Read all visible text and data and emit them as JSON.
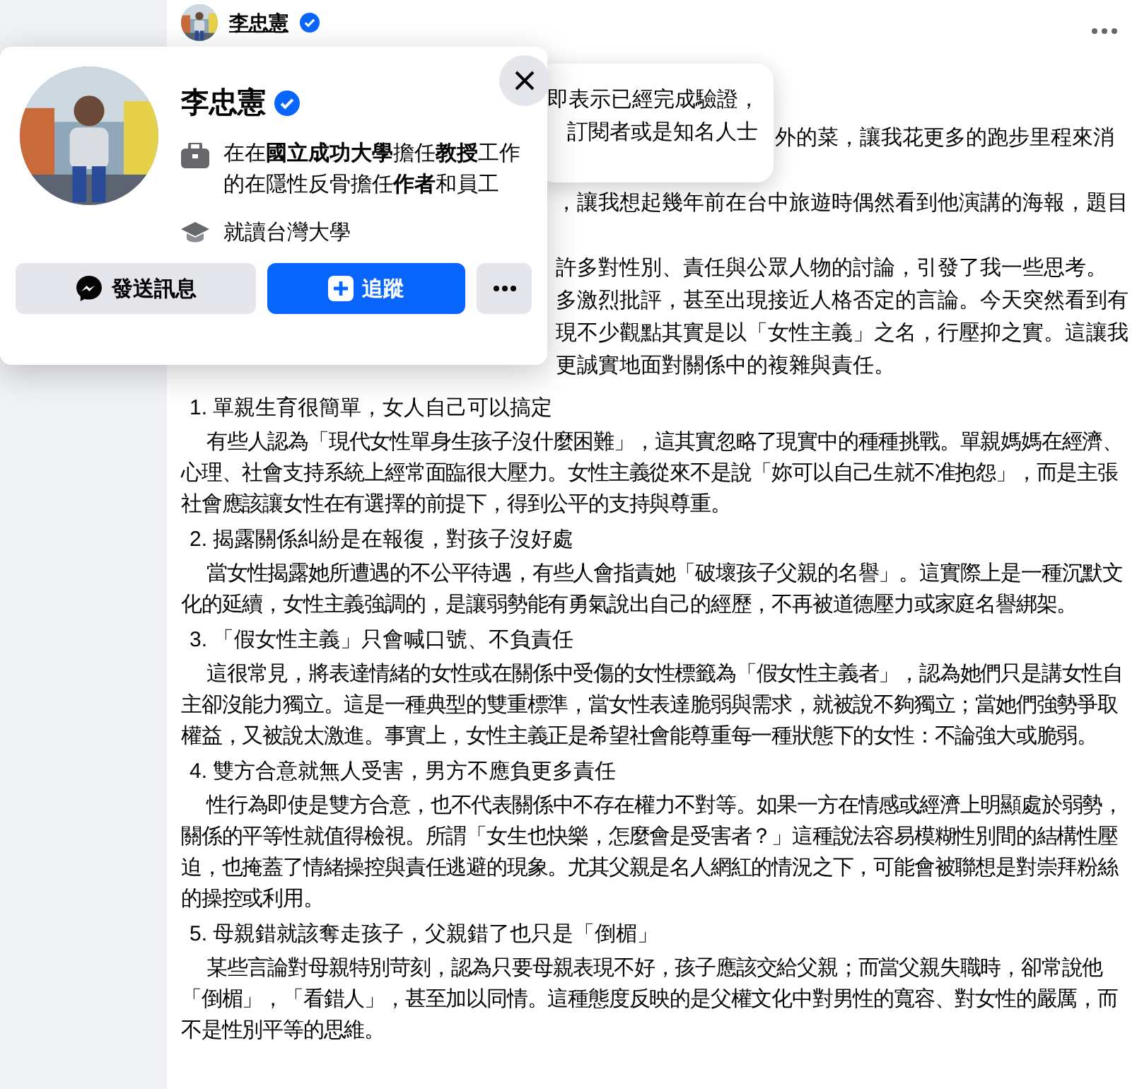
{
  "post": {
    "author": "李忠憲",
    "verified": true,
    "covered_lines": [
      {
        "kind": "after_tooltip",
        "text": "外的菜，讓我花更多的跑步里程來消"
      },
      {
        "kind": "para",
        "text": "，讓我想起幾年前在台中旅遊時偶然看到他演講的海報，題目"
      },
      {
        "kind": "para",
        "text": "許多對性別、責任與公眾人物的討論，引發了我一些思考。"
      },
      {
        "kind": "line",
        "text": "多激烈批評，甚至出現接近人格否定的言論。今天突然看到有"
      },
      {
        "kind": "line",
        "text": "現不少觀點其實是以「女性主義」之名，行壓抑之實。這讓我"
      },
      {
        "kind": "line",
        "text": "更誠實地面對關係中的複雜與責任。"
      }
    ],
    "sections": [
      {
        "heading": "1. 單親生育很簡單，女人自己可以搞定",
        "body": "有些人認為「現代女性單身生孩子沒什麼困難」，這其實忽略了現實中的種種挑戰。單親媽媽在經濟、心理、社會支持系統上經常面臨很大壓力。女性主義從來不是說「妳可以自己生就不准抱怨」，而是主張社會應該讓女性在有選擇的前提下，得到公平的支持與尊重。"
      },
      {
        "heading": "2. 揭露關係糾紛是在報復，對孩子沒好處",
        "body": "當女性揭露她所遭遇的不公平待遇，有些人會指責她「破壞孩子父親的名譽」。這實際上是一種沉默文化的延續，女性主義強調的，是讓弱勢能有勇氣說出自己的經歷，不再被道德壓力或家庭名譽綁架。"
      },
      {
        "heading": "3. 「假女性主義」只會喊口號、不負責任",
        "body": "這很常見，將表達情緒的女性或在關係中受傷的女性標籤為「假女性主義者」，認為她們只是講女性自主卻沒能力獨立。這是一種典型的雙重標準，當女性表達脆弱與需求，就被說不夠獨立；當她們強勢爭取權益，又被說太激進。事實上，女性主義正是希望社會能尊重每一種狀態下的女性：不論強大或脆弱。"
      },
      {
        "heading": "4. 雙方合意就無人受害，男方不應負更多責任",
        "body": "性行為即使是雙方合意，也不代表關係中不存在權力不對等。如果一方在情感或經濟上明顯處於弱勢，關係的平等性就值得檢視。所謂「女生也快樂，怎麼會是受害者？」這種說法容易模糊性別間的結構性壓迫，也掩蓋了情緒操控與責任逃避的現象。尤其父親是名人網紅的情況之下，可能會被聯想是對崇拜粉絲的操控或利用。"
      },
      {
        "heading": "5. 母親錯就該奪走孩子，父親錯了也只是「倒楣」",
        "body": "某些言論對母親特別苛刻，認為只要母親表現不好，孩子應該交給父親；而當父親失職時，卻常說他「倒楣」，「看錯人」，甚至加以同情。這種態度反映的是父權文化中對男性的寬容、對女性的嚴厲，而不是性別平等的思維。"
      }
    ]
  },
  "tooltip": {
    "lines": [
      "即表示已經完成驗證，",
      "訂閱者或是知名人士"
    ]
  },
  "profile_card": {
    "name": "李忠憲",
    "verified": true,
    "details": [
      {
        "kind": "work",
        "text": "在在**國立成功大學**擔任**教授**工作的在隱性反骨擔任**作者**和員工"
      },
      {
        "kind": "education",
        "text": "就讀台灣大學"
      }
    ],
    "buttons": [
      {
        "kind": "message",
        "label": "發送訊息"
      },
      {
        "kind": "follow",
        "label": "追蹤"
      },
      {
        "kind": "more"
      }
    ]
  }
}
